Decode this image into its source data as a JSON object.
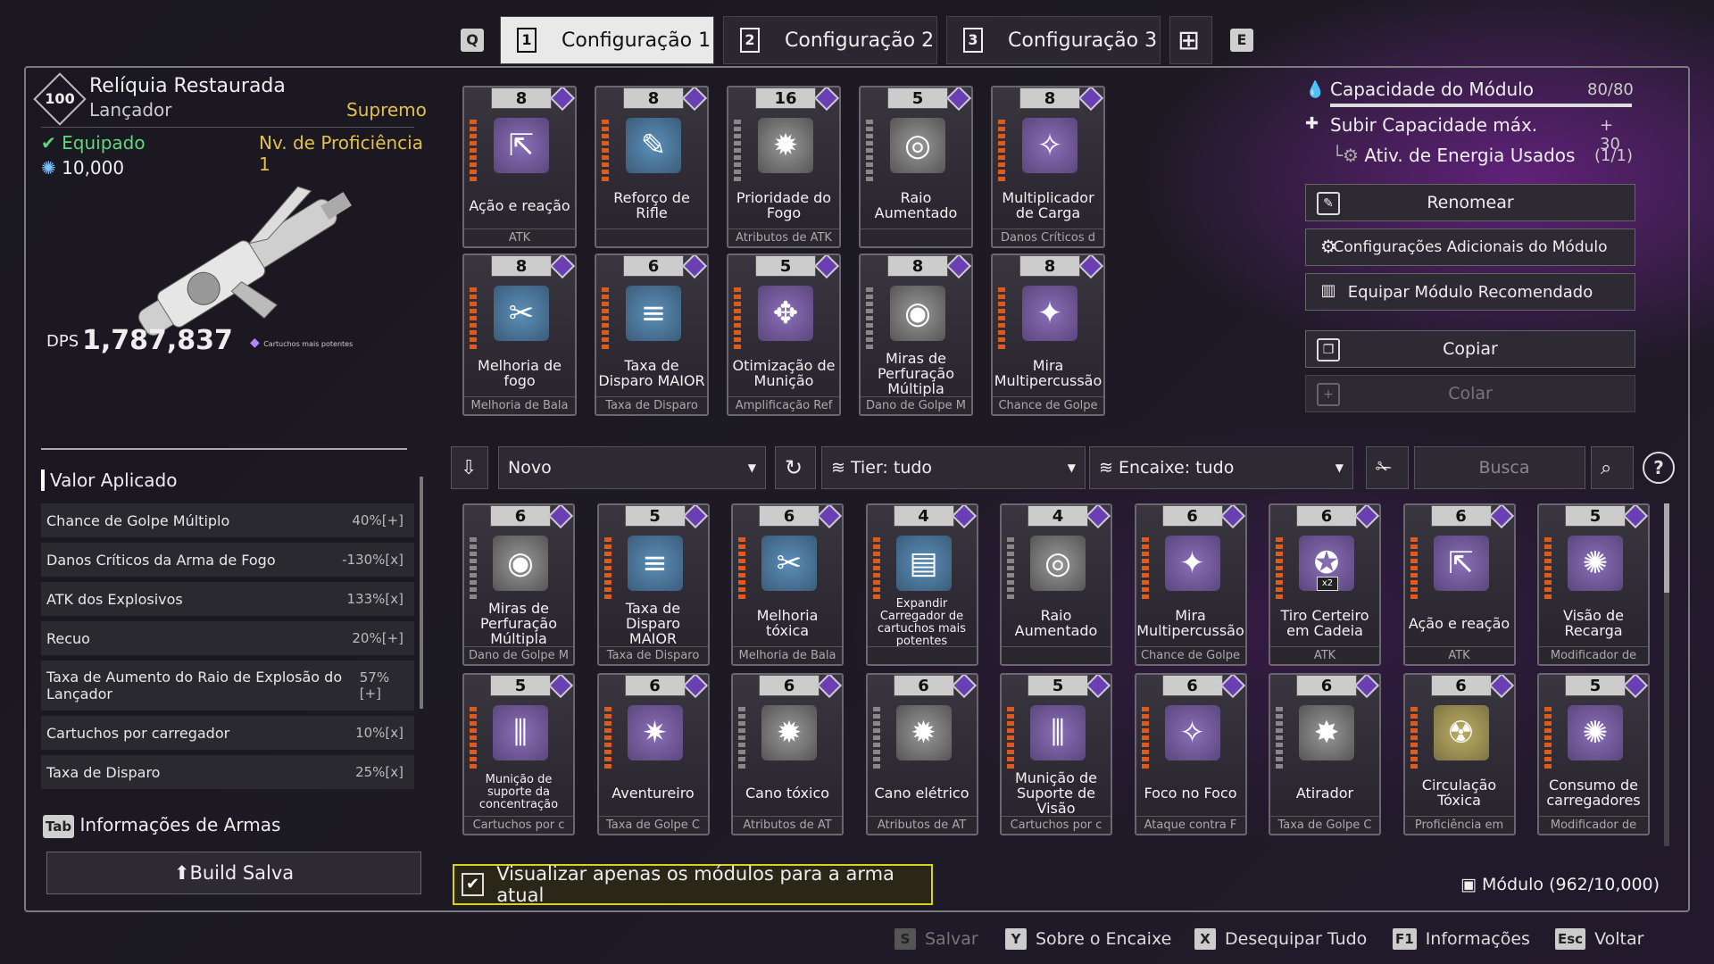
{
  "tabs": {
    "q": "Q",
    "e": "E",
    "t1": "Configuração 1",
    "t2": "Configuração 2",
    "t3": "Configuração 3",
    "n1": "1",
    "n2": "2",
    "n3": "3"
  },
  "weapon": {
    "level": "100",
    "name": "Relíquia Restaurada",
    "type": "Lançador",
    "rarity": "Supremo",
    "status": "Equipado",
    "proficiency": "Nv. de Proficiência 1",
    "value": "10,000",
    "dps_label": "DPS",
    "dps": "1,787,837",
    "ammo": "Cartuchos mais potentes"
  },
  "applied": {
    "title": "Valor Aplicado",
    "rows": [
      {
        "name": "Chance de Golpe Múltiplo",
        "val": "40%[+]"
      },
      {
        "name": "Danos Críticos da Arma de Fogo",
        "val": "-130%[x]"
      },
      {
        "name": "ATK dos Explosivos",
        "val": "133%[x]"
      },
      {
        "name": "Recuo",
        "val": "20%[+]"
      },
      {
        "name": "Taxa de Aumento do Raio de Explosão do Lançador",
        "val": "57%[+]"
      },
      {
        "name": "Cartuchos por carregador",
        "val": "10%[x]"
      },
      {
        "name": "Taxa de Disparo",
        "val": "25%[x]"
      }
    ],
    "info_key": "Tab",
    "info": "Informações de Armas",
    "build": "Build Salva"
  },
  "equipped": [
    {
      "cost": "8",
      "name": "Ação e reação",
      "ft": "ATK",
      "ico": "p",
      "sym": "⇱"
    },
    {
      "cost": "8",
      "name": "Reforço de Rifle",
      "ft": "",
      "ico": "b",
      "sym": "✎"
    },
    {
      "cost": "16",
      "name": "Prioridade do Fogo",
      "ft": "Atributos de ATK",
      "ico": "gr",
      "sym": "✹"
    },
    {
      "cost": "5",
      "name": "Raio Aumentado",
      "ft": "",
      "ico": "gr",
      "sym": "◎"
    },
    {
      "cost": "8",
      "name": "Multiplicador de Carga",
      "ft": "Danos Críticos d",
      "ico": "p",
      "sym": "✧"
    },
    {
      "cost": "8",
      "name": "Melhoria de fogo",
      "ft": "Melhoria de Bala",
      "ico": "b",
      "sym": "✂"
    },
    {
      "cost": "6",
      "name": "Taxa de Disparo MAIOR",
      "ft": "Taxa de Disparo",
      "ico": "b",
      "sym": "≡"
    },
    {
      "cost": "5",
      "name": "Otimização de Munição",
      "ft": "Amplificação Ref",
      "ico": "p",
      "sym": "✥"
    },
    {
      "cost": "8",
      "name": "Miras de Perfuração Múltipla",
      "ft": "Dano de Golpe M",
      "ico": "gr",
      "sym": "◉"
    },
    {
      "cost": "8",
      "name": "Mira Multipercussão",
      "ft": "Chance de Golpe",
      "ico": "p",
      "sym": "✦"
    }
  ],
  "capacity": {
    "label": "Capacidade do Módulo",
    "value": "80/80",
    "max_label": "Subir Capacidade máx.",
    "max_val": "+ 30",
    "energy_label": "Ativ. de Energia Usados",
    "energy_val": "(1/1)"
  },
  "actions": {
    "rename": "Renomear",
    "extra": "Configurações Adicionais do Módulo",
    "recommend": "Equipar Módulo Recomendado",
    "copy": "Copiar",
    "paste": "Colar"
  },
  "filters": {
    "sort": "Novo",
    "tier": "Tier: tudo",
    "socket": "Encaixe: tudo",
    "search_placeholder": "Busca",
    "help": "?"
  },
  "inventory": [
    {
      "cost": "6",
      "name": "Miras de Perfuração Múltipla",
      "ft": "Dano de Golpe M",
      "ico": "gr",
      "sym": "◉"
    },
    {
      "cost": "5",
      "name": "Taxa de Disparo MAIOR",
      "ft": "Taxa de Disparo",
      "ico": "b",
      "sym": "≡"
    },
    {
      "cost": "6",
      "name": "Melhoria tóxica",
      "ft": "Melhoria de Bala",
      "ico": "b",
      "sym": "✂"
    },
    {
      "cost": "4",
      "name": "Expandir Carregador de cartuchos mais potentes",
      "ft": "",
      "ico": "b",
      "sym": "▤"
    },
    {
      "cost": "4",
      "name": "Raio Aumentado",
      "ft": "",
      "ico": "gr",
      "sym": "◎"
    },
    {
      "cost": "6",
      "name": "Mira Multipercussão",
      "ft": "Chance de Golpe",
      "ico": "p",
      "sym": "✦"
    },
    {
      "cost": "6",
      "name": "Tiro Certeiro em Cadeia",
      "ft": "ATK",
      "ico": "p",
      "sym": "✪"
    },
    {
      "cost": "6",
      "name": "Ação e reação",
      "ft": "ATK",
      "ico": "p",
      "sym": "⇱"
    },
    {
      "cost": "5",
      "name": "Visão de Recarga",
      "ft": "Modificador de",
      "ico": "p",
      "sym": "✺"
    },
    {
      "cost": "5",
      "name": "Munição de suporte da concentração",
      "ft": "Cartuchos por c",
      "ico": "p",
      "sym": "⫼"
    },
    {
      "cost": "6",
      "name": "Aventureiro",
      "ft": "Taxa de Golpe C",
      "ico": "p",
      "sym": "✷"
    },
    {
      "cost": "6",
      "name": "Cano tóxico",
      "ft": "Atributos de AT",
      "ico": "gr",
      "sym": "✹"
    },
    {
      "cost": "6",
      "name": "Cano elétrico",
      "ft": "Atributos de AT",
      "ico": "gr",
      "sym": "✹"
    },
    {
      "cost": "5",
      "name": "Munição de Suporte de Visão",
      "ft": "Cartuchos por c",
      "ico": "p",
      "sym": "⫼"
    },
    {
      "cost": "6",
      "name": "Foco no Foco",
      "ft": "Ataque contra F",
      "ico": "p",
      "sym": "✧"
    },
    {
      "cost": "6",
      "name": "Atirador",
      "ft": "Taxa de Golpe C",
      "ico": "gr",
      "sym": "✸"
    },
    {
      "cost": "6",
      "name": "Circulação Tóxica",
      "ft": "Proficiência em",
      "ico": "y",
      "sym": "☢"
    },
    {
      "cost": "5",
      "name": "Consumo de carregadores",
      "ft": "Modificador de",
      "ico": "p",
      "sym": "✺"
    }
  ],
  "footer": {
    "checkbox": "Visualizar apenas os módulos para a arma atual",
    "module_count": "Módulo (962/10,000)",
    "save_key": "S",
    "save": "Salvar",
    "y_key": "Y",
    "about": "Sobre o Encaixe",
    "x_key": "X",
    "unequip": "Desequipar Tudo",
    "f1_key": "F1",
    "info": "Informações",
    "esc_key": "Esc",
    "back": "Voltar"
  },
  "x2": "x2"
}
